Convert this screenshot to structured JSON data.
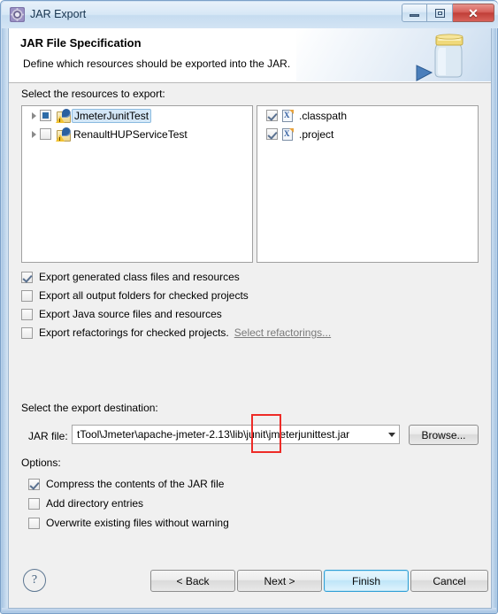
{
  "window": {
    "title": "JAR Export",
    "icon": "jar-export-gear-icon",
    "controls": {
      "minimize": "minimize-icon",
      "maximize": "maximize-icon",
      "close": "✕"
    }
  },
  "header": {
    "title": "JAR File Specification",
    "subtitle": "Define which resources should be exported into the JAR.",
    "icon": "jar-jar-icon"
  },
  "main": {
    "resources_label": "Select the resources to export:",
    "left_tree": [
      {
        "label": "JmeterJunitTest",
        "check_state": "partial",
        "selected": true,
        "expandable": true,
        "icon": "java-project-warning-icon"
      },
      {
        "label": "RenaultHUPServiceTest",
        "check_state": "unchecked",
        "selected": false,
        "expandable": true,
        "icon": "java-project-warning-icon"
      }
    ],
    "right_tree": [
      {
        "label": ".classpath",
        "check_state": "checked",
        "icon": "xml-file-icon"
      },
      {
        "label": ".project",
        "check_state": "checked",
        "icon": "xml-file-icon"
      }
    ],
    "export_options": [
      {
        "label": "Export generated class files and resources",
        "checked": true
      },
      {
        "label": "Export all output folders for checked projects",
        "checked": false
      },
      {
        "label": "Export Java source files and resources",
        "checked": false
      },
      {
        "label": "Export refactorings for checked projects.",
        "checked": false,
        "link": "Select refactorings..."
      }
    ],
    "destination_label": "Select the export destination:",
    "jar_file_label": "JAR file:",
    "jar_file_value": "tTool\\Jmeter\\apache-jmeter-2.13\\lib\\junit\\jmeterjunittest.jar",
    "browse_label": "Browse...",
    "options_label": "Options:",
    "options": [
      {
        "label": "Compress the contents of the JAR file",
        "checked": true
      },
      {
        "label": "Add directory entries",
        "checked": false
      },
      {
        "label": "Overwrite existing files without warning",
        "checked": false
      }
    ],
    "annotation_color": "#ee2b27"
  },
  "footer": {
    "help": "?",
    "back": "< Back",
    "next": "Next >",
    "finish": "Finish",
    "cancel": "Cancel"
  }
}
